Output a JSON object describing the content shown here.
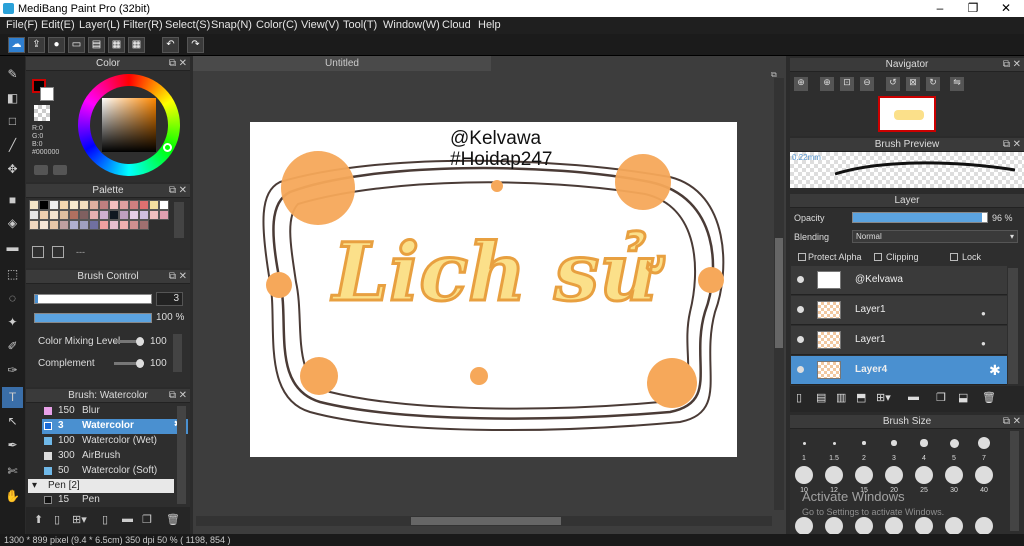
{
  "window": {
    "title": "MediBang Paint Pro (32bit)"
  },
  "menu": [
    "File(F)",
    "Edit(E)",
    "Layer(L)",
    "Filter(R)",
    "Select(S)",
    "Snap(N)",
    "Color(C)",
    "View(V)",
    "Tool(T)",
    "Window(W)",
    "Cloud",
    "Help"
  ],
  "color_panel": {
    "title": "Color",
    "rgb": [
      "R:0",
      "G:0",
      "B:0"
    ],
    "hex": "#000000",
    "fg": "#cc0000"
  },
  "palette_panel": {
    "title": "Palette",
    "extra": "---",
    "swatches": [
      "#f5e6c8",
      "#000000",
      "#f0f0f0",
      "#f5d7b0",
      "#f7ead0",
      "#f5e0c0",
      "#e0b0a0",
      "#c08080",
      "#f5c0c0",
      "#e0a0a0",
      "#d08080",
      "#e07070",
      "#f5e0a0",
      "#ffffff",
      "#e8e8e8",
      "#f0d0b0",
      "#f5e5d0",
      "#e0c0a0",
      "#b07060",
      "#806060",
      "#e8b0b0",
      "#d0b0d0",
      "#101820",
      "#c0a0c0",
      "#e8d0e8",
      "#d0c0e0",
      "#f0c0c0",
      "#e0a0b0",
      "#f0d8c0",
      "#f8e8d8",
      "#e8c8a8",
      "#c0a0a0",
      "#b0b0d0",
      "#a0a0c0",
      "#7070a0",
      "#f0a0a0",
      "#e8c0d0",
      "#f0b0b0",
      "#d09090",
      "#a07070"
    ]
  },
  "brush_control": {
    "title": "Brush Control",
    "size": "3",
    "opacity": "100 %",
    "mixing_label": "Color Mixing Level",
    "mixing": "100",
    "complement_label": "Complement",
    "complement": "100"
  },
  "brush_list": {
    "title": "Brush: Watercolor",
    "items": [
      {
        "size": "150",
        "name": "Blur",
        "color": "#e8a0e8"
      },
      {
        "size": "3",
        "name": "Watercolor",
        "color": "#1a6bd8"
      },
      {
        "size": "100",
        "name": "Watercolor (Wet)",
        "color": "#6fb8e8"
      },
      {
        "size": "300",
        "name": "AirBrush",
        "color": "#dddddd"
      },
      {
        "size": "50",
        "name": "Watercolor (Soft)",
        "color": "#6fb8e8"
      }
    ],
    "group": "Pen [2]",
    "pen": {
      "size": "15",
      "name": "Pen"
    }
  },
  "canvas": {
    "tab": "Untitled",
    "text1": "@Kelvawa",
    "text2": "#Hoidap247",
    "art_text": "Lich sử"
  },
  "navigator": {
    "title": "Navigator"
  },
  "brush_preview": {
    "title": "Brush Preview",
    "size": "0.22mm"
  },
  "layer_panel": {
    "title": "Layer",
    "opacity_label": "Opacity",
    "opacity": "96 %",
    "opacity_value": 96,
    "blending_label": "Blending",
    "blending": "Normal",
    "protect_alpha": "Protect Alpha",
    "clipping": "Clipping",
    "lock": "Lock",
    "layers": [
      {
        "name": "@Kelvawa",
        "selected": false
      },
      {
        "name": "Layer1",
        "selected": false
      },
      {
        "name": "Layer1",
        "selected": false
      },
      {
        "name": "Layer4",
        "selected": true
      }
    ]
  },
  "brush_size_panel": {
    "title": "Brush Size",
    "sizes": [
      "1",
      "1.5",
      "2",
      "3",
      "4",
      "5",
      "7",
      "10",
      "12",
      "15",
      "20",
      "25",
      "30",
      "40"
    ],
    "watermark1": "Activate Windows",
    "watermark2": "Go to Settings to activate Windows."
  },
  "status": {
    "info": "1300 * 899 pixel   (9.4 * 6.5cm)   350 dpi   50 %   ( 1198, 854 )"
  }
}
